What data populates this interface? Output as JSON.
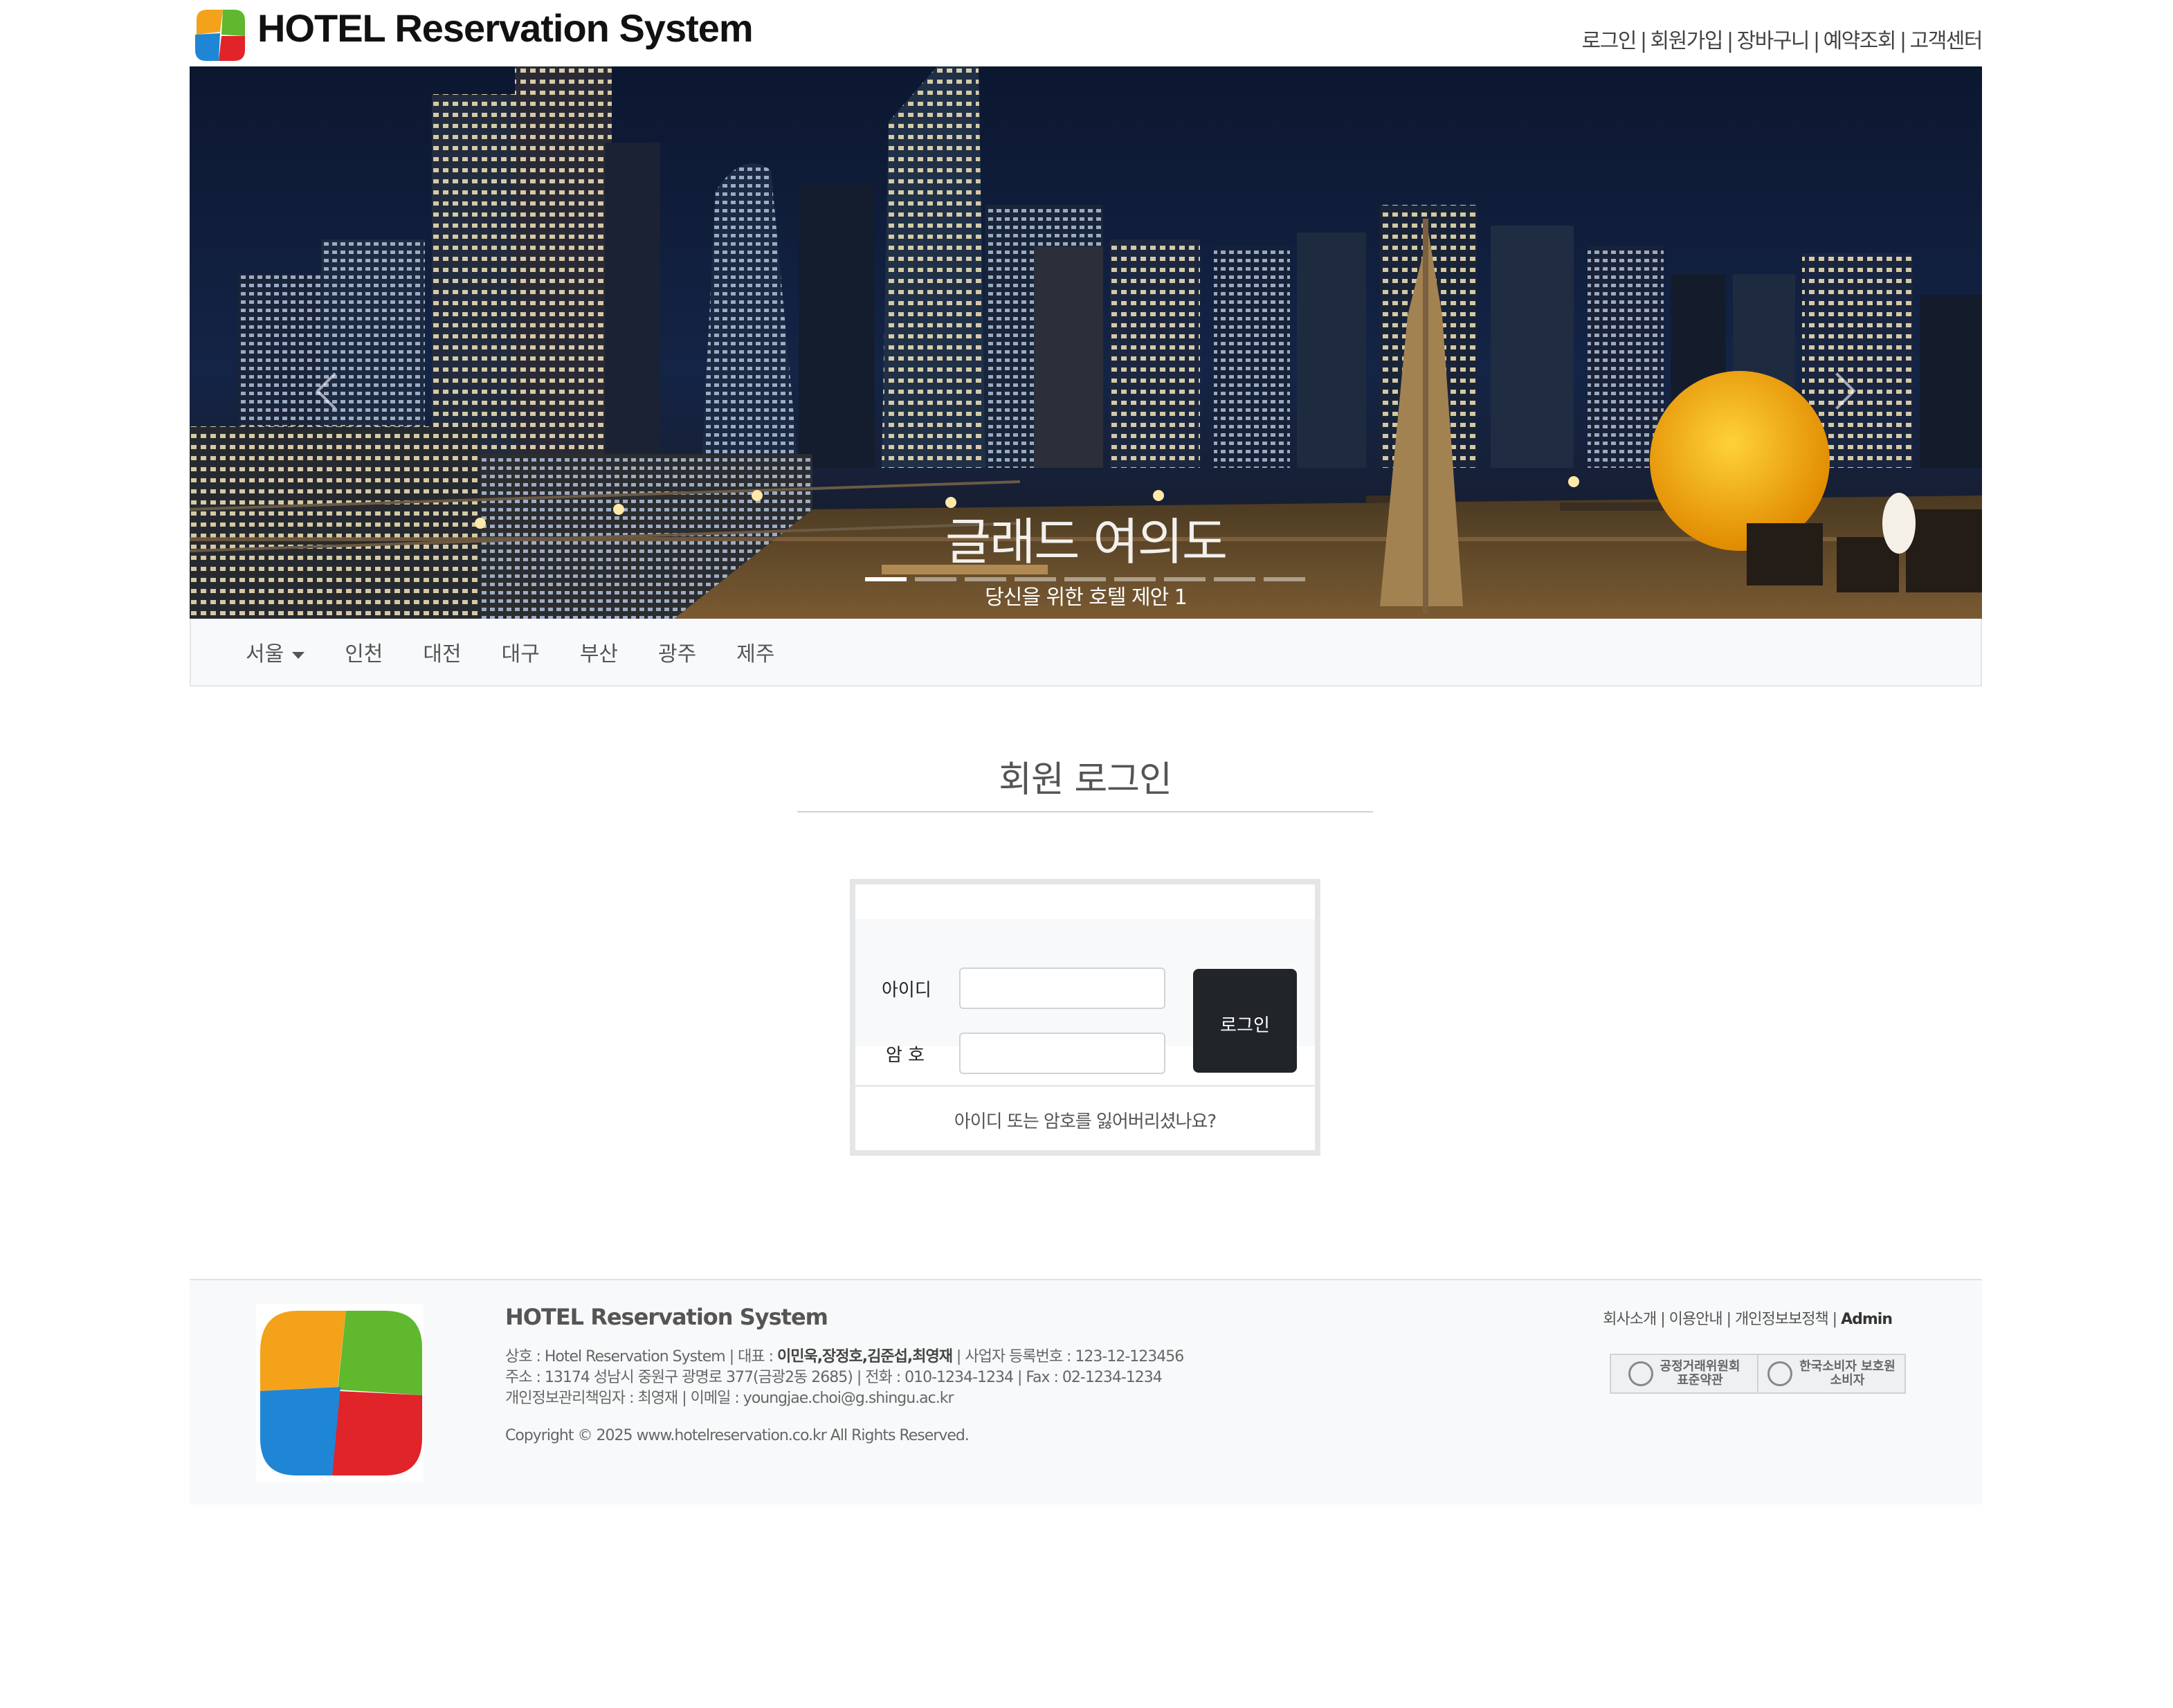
{
  "header": {
    "brand": "HOTEL Reservation System",
    "nav": [
      "로그인",
      "회원가입",
      "장바구니",
      "예약조회",
      "고객센터"
    ]
  },
  "hero": {
    "title": "글래드 여의도",
    "subtitle": "당신을 위한 호텔 제안 1",
    "slide_count": 9,
    "active_slide": 1
  },
  "regions": {
    "items": [
      "서울",
      "인천",
      "대전",
      "대구",
      "부산",
      "광주",
      "제주"
    ]
  },
  "login": {
    "page_title": "회원 로그인",
    "id_label": "아이디",
    "pw_label": "암 호",
    "id_value": "",
    "pw_value": "",
    "button": "로그인",
    "forgot": "아이디 또는 암호를 잃어버리셨나요?"
  },
  "footer": {
    "brand": "HOTEL Reservation System",
    "line1_prefix": "상호 : Hotel Reservation System | 대표 : ",
    "representatives": "이민욱,장정호,김준섭,최영재",
    "line1_suffix": " | 사업자 등록번호 : 123-12-123456",
    "line2": "주소 : 13174 성남시 중원구 광명로 377(금광2동 2685) | 전화 : 010-1234-1234 | Fax : 02-1234-1234",
    "line3": "개인정보관리책임자 : 최영재 | 이메일 : youngjae.choi@g.shingu.ac.kr",
    "copyright": "Copyright © 2025 www.hotelreservation.co.kr   All Rights Reserved.",
    "links": [
      "회사소개",
      "이용안내",
      "개인정보보정책"
    ],
    "admin": "Admin",
    "badge1_line1": "공정거래위원회",
    "badge1_line2": "표준약관",
    "badge2_line1": "한국소비자 보호원",
    "badge2_line2": "소비자"
  },
  "colors": {
    "dark_button": "#212529",
    "nav_bg": "#f8f9fa"
  }
}
